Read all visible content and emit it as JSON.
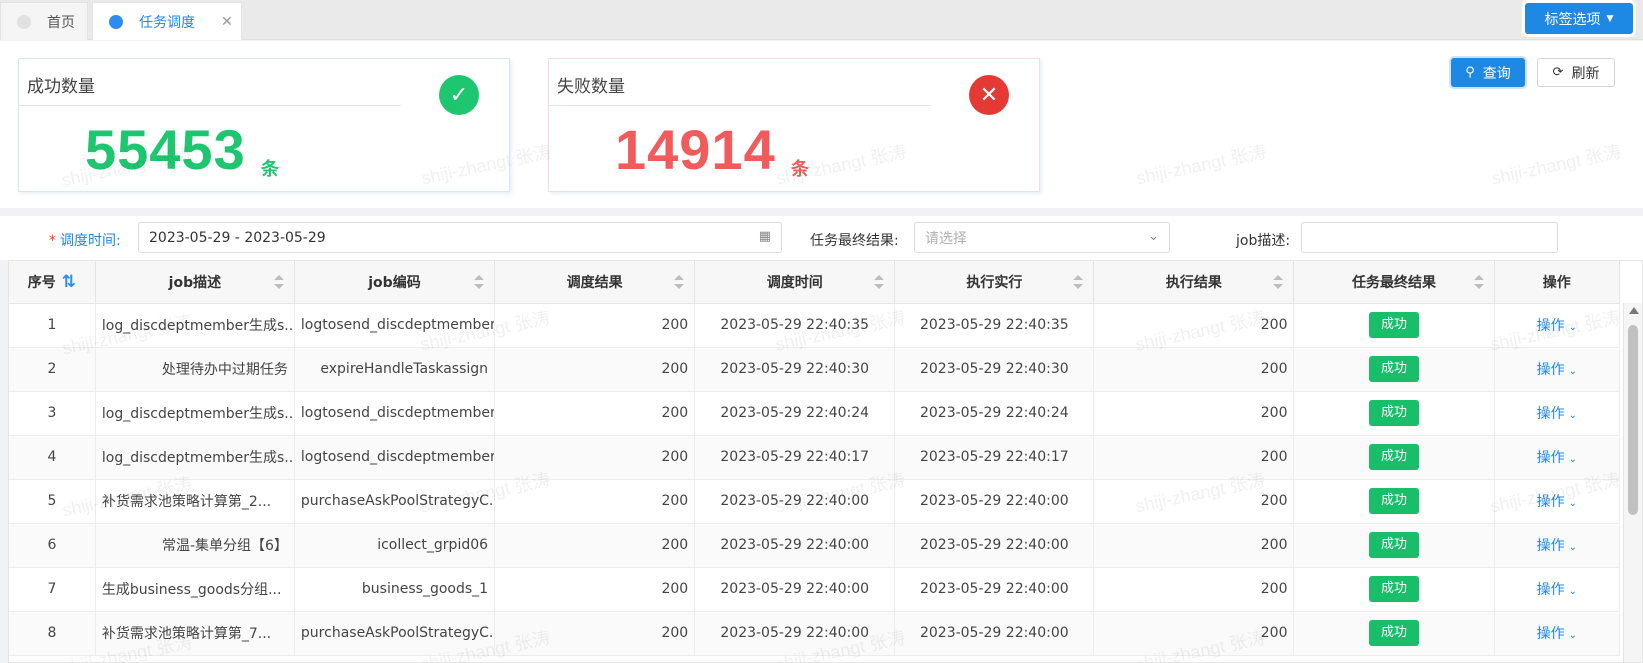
{
  "tabs": [
    {
      "label": "首页",
      "active": false
    },
    {
      "label": "任务调度",
      "active": true,
      "close": "✕"
    }
  ],
  "tag_options": {
    "label": "标签选项"
  },
  "stats": {
    "success": {
      "title": "成功数量",
      "value": "55453",
      "unit": "条",
      "color": "#1ec66f"
    },
    "fail": {
      "title": "失败数量",
      "value": "14914",
      "unit": "条",
      "color": "#f25b5b"
    }
  },
  "actions": {
    "query": "查询",
    "refresh": "刷新"
  },
  "watermark": "shiji-zhangt 张涛",
  "filters": {
    "schedule_time_label": "调度时间:",
    "schedule_time_value": "2023-05-29 - 2023-05-29",
    "final_result_label": "任务最终结果:",
    "final_result_placeholder": "请选择",
    "job_desc_label": "job描述:"
  },
  "table": {
    "columns": [
      "序号",
      "job描述",
      "job编码",
      "调度结果",
      "调度时间",
      "执行实行",
      "执行结果",
      "任务最终结果",
      "操作"
    ],
    "rows": [
      {
        "no": "1",
        "desc": "log_discdeptmember生成s...",
        "code": "logtosend_discdeptmember",
        "sched_result": "200",
        "sched_time": "2023-05-29 22:40:35",
        "exec_time": "2023-05-29 22:40:35",
        "exec_result": "200",
        "final": "成功",
        "op": "操作"
      },
      {
        "no": "2",
        "desc": "处理待办中过期任务",
        "code": "expireHandleTaskassign",
        "sched_result": "200",
        "sched_time": "2023-05-29 22:40:30",
        "exec_time": "2023-05-29 22:40:30",
        "exec_result": "200",
        "final": "成功",
        "op": "操作"
      },
      {
        "no": "3",
        "desc": "log_discdeptmember生成s...",
        "code": "logtosend_discdeptmember",
        "sched_result": "200",
        "sched_time": "2023-05-29 22:40:24",
        "exec_time": "2023-05-29 22:40:24",
        "exec_result": "200",
        "final": "成功",
        "op": "操作"
      },
      {
        "no": "4",
        "desc": "log_discdeptmember生成s...",
        "code": "logtosend_discdeptmember",
        "sched_result": "200",
        "sched_time": "2023-05-29 22:40:17",
        "exec_time": "2023-05-29 22:40:17",
        "exec_result": "200",
        "final": "成功",
        "op": "操作"
      },
      {
        "no": "5",
        "desc": "补货需求池策略计算第_2...",
        "code": "purchaseAskPoolStrategyC...",
        "sched_result": "200",
        "sched_time": "2023-05-29 22:40:00",
        "exec_time": "2023-05-29 22:40:00",
        "exec_result": "200",
        "final": "成功",
        "op": "操作"
      },
      {
        "no": "6",
        "desc": "常温-集单分组【6】",
        "code": "icollect_grpid06",
        "sched_result": "200",
        "sched_time": "2023-05-29 22:40:00",
        "exec_time": "2023-05-29 22:40:00",
        "exec_result": "200",
        "final": "成功",
        "op": "操作"
      },
      {
        "no": "7",
        "desc": "生成business_goods分组...",
        "code": "business_goods_1",
        "sched_result": "200",
        "sched_time": "2023-05-29 22:40:00",
        "exec_time": "2023-05-29 22:40:00",
        "exec_result": "200",
        "final": "成功",
        "op": "操作"
      },
      {
        "no": "8",
        "desc": "补货需求池策略计算第_7...",
        "code": "purchaseAskPoolStrategyC...",
        "sched_result": "200",
        "sched_time": "2023-05-29 22:40:00",
        "exec_time": "2023-05-29 22:40:00",
        "exec_result": "200",
        "final": "成功",
        "op": "操作"
      }
    ]
  }
}
